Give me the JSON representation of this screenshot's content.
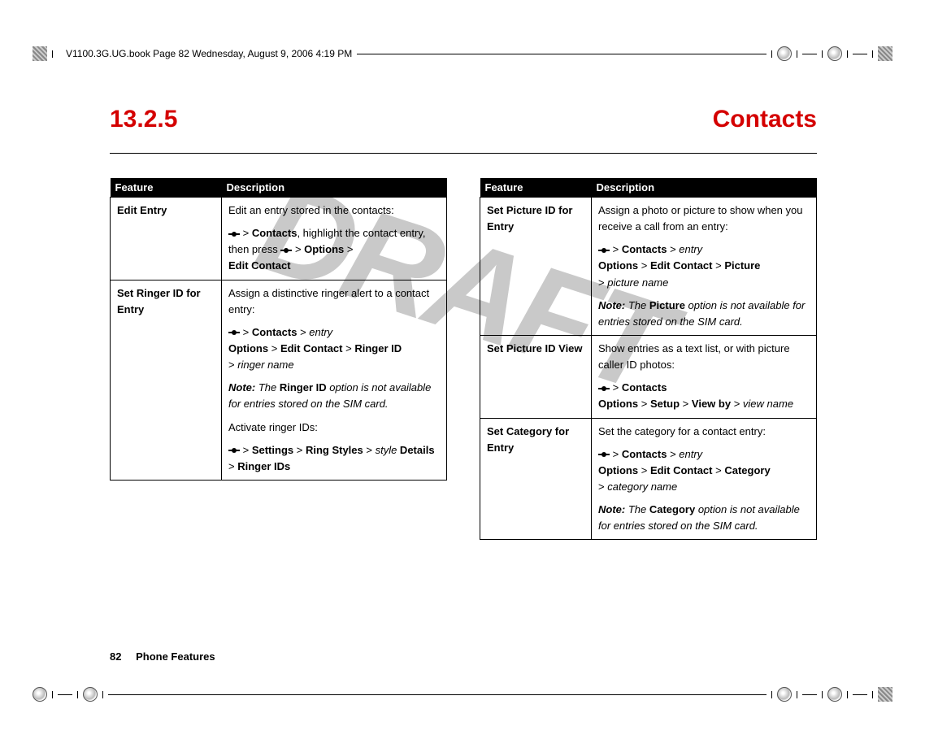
{
  "meta": {
    "header_line": "V1100.3G.UG.book  Page 82  Wednesday, August 9, 2006  4:19 PM"
  },
  "watermark": "DRAFT",
  "heading": {
    "number": "13.2.5",
    "title": "Contacts"
  },
  "table_headers": {
    "feature": "Feature",
    "description": "Description"
  },
  "left_table": {
    "rows": [
      {
        "feature": "Edit Entry",
        "d1": "Edit an entry stored in the contacts:",
        "d2a": " > ",
        "d2b": "Contacts",
        "d2c": ", highlight the contact entry, then press ",
        "d2d": " > ",
        "d2e": "Options",
        "d2f": " > ",
        "d2g": "Edit Contact"
      },
      {
        "feature": "Set Ringer ID for Entry",
        "d1": "Assign a distinctive ringer alert to a contact entry:",
        "p2a": " > ",
        "p2b": "Contacts",
        "p2c": " > ",
        "p2d": "entry",
        "p3a": "Options",
        "p3b": " > ",
        "p3c": "Edit Contact",
        "p3d": " > ",
        "p3e": "Ringer ID",
        "p4a": "> ",
        "p4b": "ringer name",
        "note_label": "Note: ",
        "note_a": "The ",
        "note_b": "Ringer ID",
        "note_c": " option is not available for entries stored on the SIM card.",
        "d5": "Activate ringer IDs:",
        "p6a": " > ",
        "p6b": "Settings",
        "p6c": " > ",
        "p6d": "Ring Styles",
        "p6e": " > ",
        "p6f": "style",
        "p6g": " Details",
        "p7a": "> ",
        "p7b": "Ringer IDs"
      }
    ]
  },
  "right_table": {
    "rows": [
      {
        "feature": "Set Picture ID for Entry",
        "d1": "Assign a photo or picture to show when you receive a call from an entry:",
        "p2a": " > ",
        "p2b": "Contacts",
        "p2c": " > ",
        "p2d": "entry",
        "p3a": "Options",
        "p3b": " > ",
        "p3c": "Edit Contact",
        "p3d": " > ",
        "p3e": "Picture",
        "p4a": "> ",
        "p4b": "picture name",
        "note_label": "Note: ",
        "note_a": "The ",
        "note_b": "Picture",
        "note_c": " option is not available for entries stored on the SIM card."
      },
      {
        "feature": "Set Picture ID View",
        "d1": "Show entries as a text list, or with picture caller ID photos:",
        "p2a": " > ",
        "p2b": "Contacts",
        "p3a": "Options",
        "p3b": " > ",
        "p3c": "Setup",
        "p3d": " > ",
        "p3e": "View by",
        "p3f": " > ",
        "p3g": "view name"
      },
      {
        "feature": "Set Category for Entry",
        "d1": "Set the category for a contact entry:",
        "p2a": " > ",
        "p2b": "Contacts",
        "p2c": " > ",
        "p2d": "entry",
        "p3a": "Options",
        "p3b": " > ",
        "p3c": "Edit Contact",
        "p3d": " > ",
        "p3e": "Category",
        "p4a": "> ",
        "p4b": "category name",
        "note_label": "Note: ",
        "note_a": "The ",
        "note_b": "Category",
        "note_c": " option is not available for entries stored on the SIM card."
      }
    ]
  },
  "footer": {
    "page_number": "82",
    "chapter": "Phone Features"
  }
}
